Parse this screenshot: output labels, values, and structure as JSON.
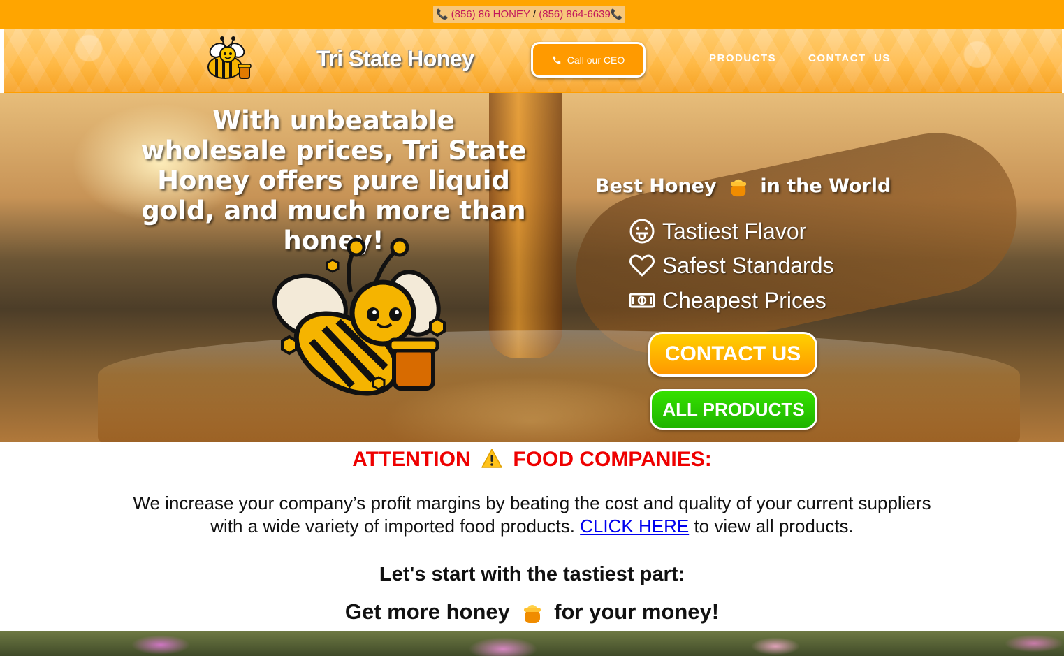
{
  "topbar": {
    "phone1": "(856) 86 HONEY",
    "separator": "/",
    "phone2": "(856) 864-6639",
    "phone_icon": "phone-icon"
  },
  "header": {
    "brand": "Tri State Honey",
    "ceo_button": "Call our CEO",
    "nav": [
      "PRODUCTS",
      "CONTACT  US"
    ],
    "logo_icon": "bee-logo-icon"
  },
  "hero": {
    "title": "With unbeatable wholesale prices, Tri State Honey offers pure liquid gold, and much more than honey!",
    "best_prefix": "Best Honey",
    "best_suffix": "in the World",
    "features": [
      {
        "icon": "tongue-face-icon",
        "label": "Tastiest Flavor"
      },
      {
        "icon": "heart-icon",
        "label": "Safest Standards"
      },
      {
        "icon": "money-bill-icon",
        "label": "Cheapest Prices"
      }
    ],
    "contact_button": "CONTACT US",
    "products_button": "ALL PRODUCTS"
  },
  "content": {
    "attention_before": "ATTENTION",
    "attention_after": "FOOD COMPANIES:",
    "para_before": "We increase your company’s profit margins by beating the cost and quality of your current suppliers with a wide variety of imported food products.",
    "para_link": "CLICK HERE",
    "para_after": "to view all products.",
    "start": "Let's start with the tastiest part:",
    "money_before": "Get more honey",
    "money_after": "for your money!"
  },
  "colors": {
    "topbar": "#ffa500",
    "accent_orange": "#ff9a00",
    "phone_text": "#c2185b",
    "attention_red": "#ee0000",
    "green_button": "#2acb00",
    "link_blue": "#0000ee"
  }
}
